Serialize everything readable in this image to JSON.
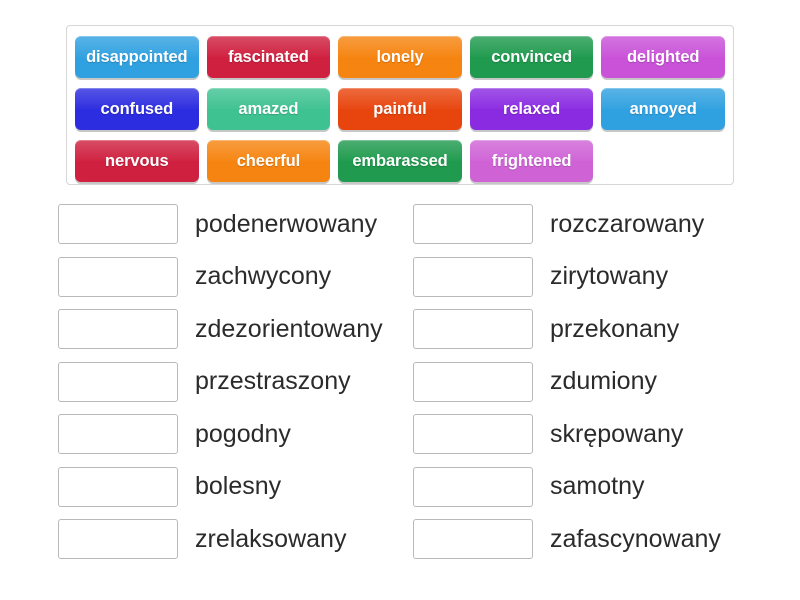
{
  "activity": {
    "type": "match-up",
    "language_pair": "English - Polish"
  },
  "tile_bank": {
    "rows": [
      [
        {
          "label": "disappointed",
          "color": "#30a1e0"
        },
        {
          "label": "fascinated",
          "color": "#cf203f"
        },
        {
          "label": "lonely",
          "color": "#f68410"
        },
        {
          "label": "convinced",
          "color": "#1f9a4e"
        },
        {
          "label": "delighted",
          "color": "#c952d8"
        }
      ],
      [
        {
          "label": "confused",
          "color": "#2c2ce0"
        },
        {
          "label": "amazed",
          "color": "#3fc292"
        },
        {
          "label": "painful",
          "color": "#e8450e"
        },
        {
          "label": "relaxed",
          "color": "#8a2be2"
        },
        {
          "label": "annoyed",
          "color": "#30a1e0"
        }
      ],
      [
        {
          "label": "nervous",
          "color": "#cf203f"
        },
        {
          "label": "cheerful",
          "color": "#f68410"
        },
        {
          "label": "embarassed",
          "color": "#1f9a4e"
        },
        {
          "label": "frightened",
          "color": "#cf63d6"
        },
        {
          "label": "",
          "color": "transparent",
          "empty": true
        }
      ]
    ]
  },
  "answers": {
    "rows": [
      {
        "left": {
          "word": "podenerwowany",
          "box_value": ""
        },
        "right": {
          "word": "rozczarowany",
          "box_value": ""
        }
      },
      {
        "left": {
          "word": "zachwycony",
          "box_value": ""
        },
        "right": {
          "word": "zirytowany",
          "box_value": ""
        }
      },
      {
        "left": {
          "word": "zdezorientowany",
          "box_value": ""
        },
        "right": {
          "word": "przekonany",
          "box_value": ""
        }
      },
      {
        "left": {
          "word": "przestraszony",
          "box_value": ""
        },
        "right": {
          "word": "zdumiony",
          "box_value": ""
        }
      },
      {
        "left": {
          "word": "pogodny",
          "box_value": ""
        },
        "right": {
          "word": "skrępowany",
          "box_value": ""
        }
      },
      {
        "left": {
          "word": "bolesny",
          "box_value": ""
        },
        "right": {
          "word": "samotny",
          "box_value": ""
        }
      },
      {
        "left": {
          "word": "zrelaksowany",
          "box_value": ""
        },
        "right": {
          "word": "zafascynowany",
          "box_value": ""
        }
      }
    ]
  },
  "colors": {
    "page_background": "#ffffff",
    "bank_border": "#d6d6d6",
    "drop_box_border": "#b9b9b9",
    "word_text": "#2b2b2b",
    "tile_text": "#ffffff"
  }
}
